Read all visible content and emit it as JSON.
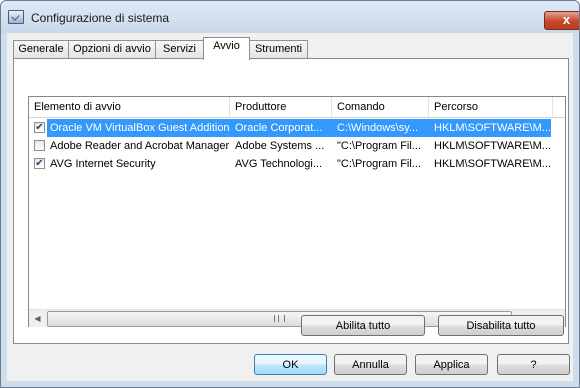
{
  "window": {
    "title": "Configurazione di sistema",
    "close_label": "x"
  },
  "tabs": [
    {
      "label": "Generale"
    },
    {
      "label": "Opzioni di avvio"
    },
    {
      "label": "Servizi"
    },
    {
      "label": "Avvio"
    },
    {
      "label": "Strumenti"
    }
  ],
  "active_tab": "Avvio",
  "columns": [
    {
      "label": "Elemento di avvio"
    },
    {
      "label": "Produttore"
    },
    {
      "label": "Comando"
    },
    {
      "label": "Percorso"
    }
  ],
  "rows": [
    {
      "checked": true,
      "selected": true,
      "cells": [
        "Oracle VM VirtualBox Guest Additions",
        "Oracle Corporat...",
        "C:\\Windows\\sy...",
        "HKLM\\SOFTWARE\\M..."
      ]
    },
    {
      "checked": false,
      "selected": false,
      "cells": [
        "Adobe Reader and Acrobat Manager",
        "Adobe Systems ...",
        "\"C:\\Program Fil...",
        "HKLM\\SOFTWARE\\M..."
      ]
    },
    {
      "checked": true,
      "selected": false,
      "cells": [
        "AVG Internet Security",
        "AVG Technologi...",
        "\"C:\\Program Fil...",
        "HKLM\\SOFTWARE\\M..."
      ]
    }
  ],
  "panel_buttons": {
    "enable_all": "Abilita tutto",
    "disable_all": "Disabilita tutto"
  },
  "dialog_buttons": {
    "ok": "OK",
    "cancel": "Annulla",
    "apply": "Applica",
    "help": "?"
  }
}
